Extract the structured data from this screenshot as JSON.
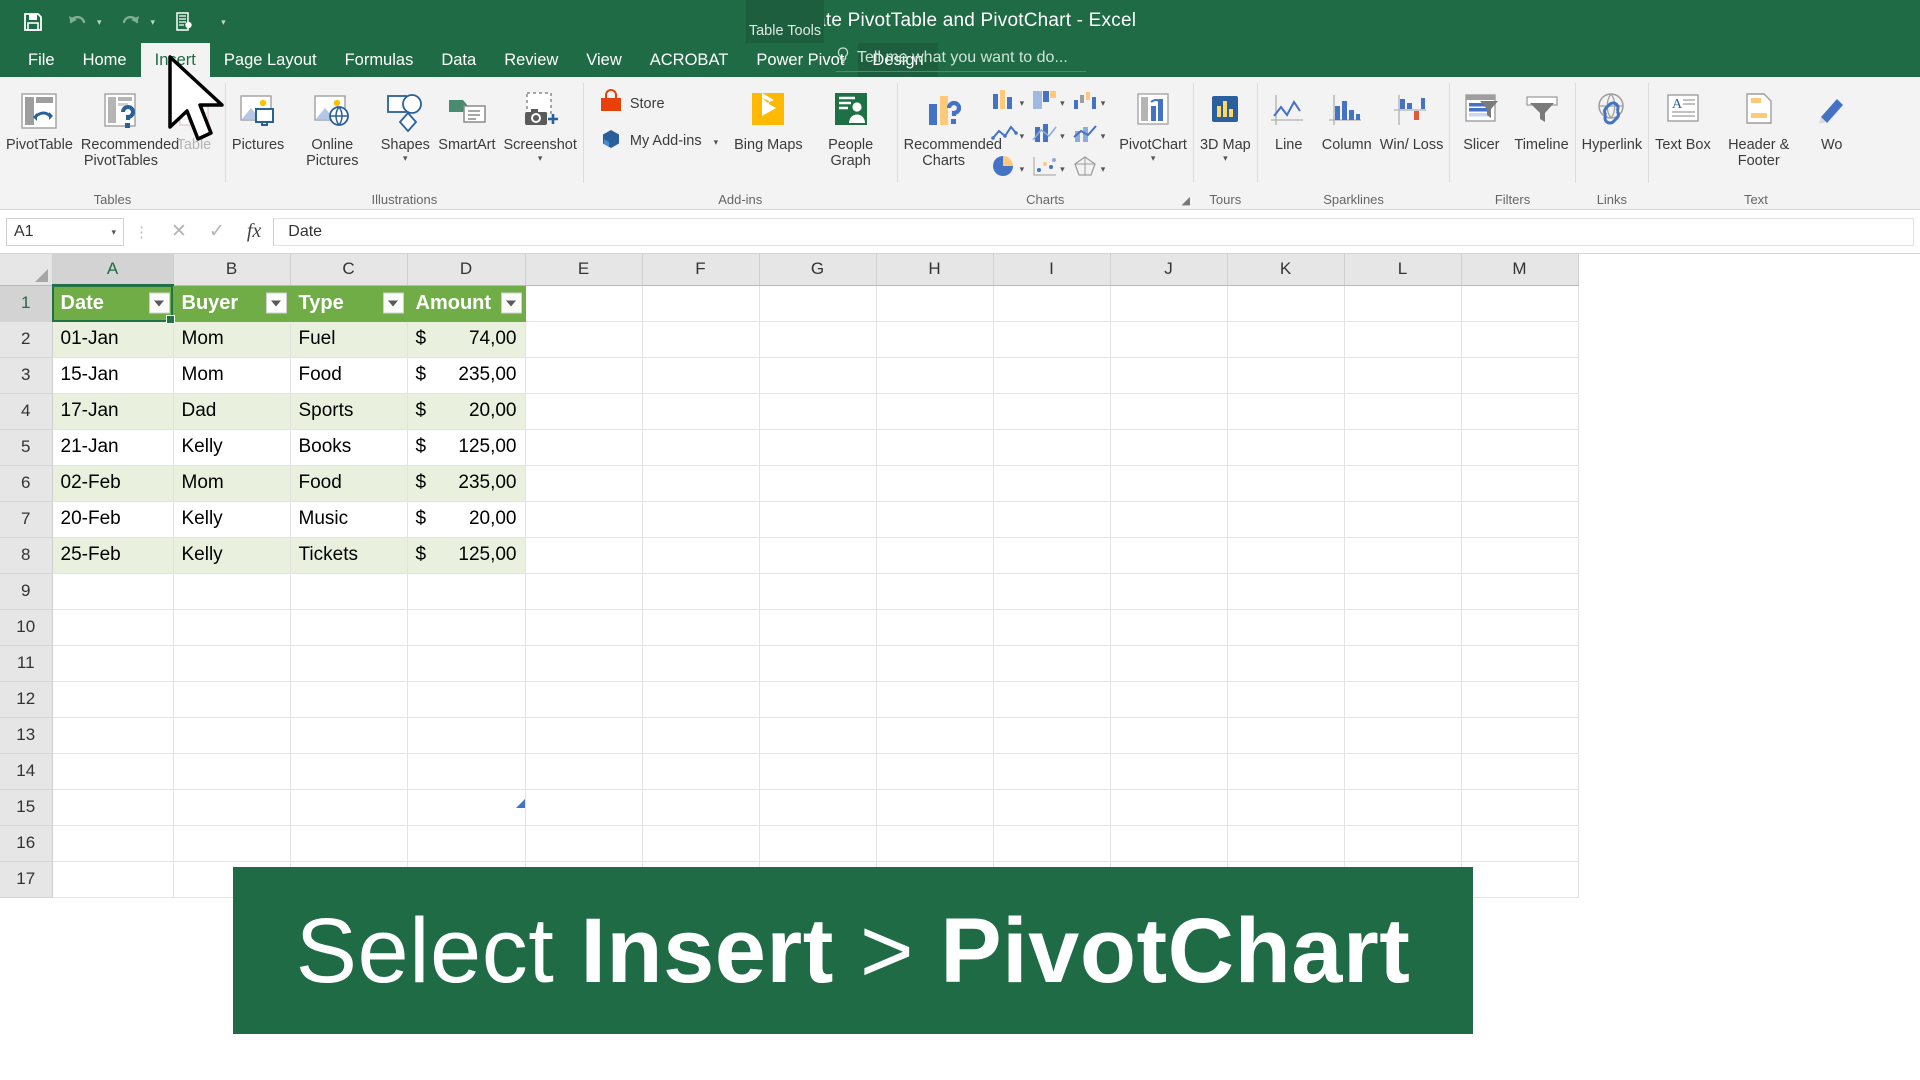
{
  "titlebar": {
    "document_title": "Create PivotTable and PivotChart - Excel",
    "contextual_tab_group": "Table Tools",
    "quick_access": [
      {
        "name": "save-icon",
        "label": "Save"
      },
      {
        "name": "undo-icon",
        "label": "Undo"
      },
      {
        "name": "redo-icon",
        "label": "Redo"
      },
      {
        "name": "print-preview-icon",
        "label": "Print Preview and Print"
      },
      {
        "name": "customize-qat-icon",
        "label": "Customize Quick Access Toolbar"
      }
    ]
  },
  "tabs": [
    {
      "label": "File",
      "active": false
    },
    {
      "label": "Home",
      "active": false
    },
    {
      "label": "Insert",
      "active": true
    },
    {
      "label": "Page Layout",
      "active": false
    },
    {
      "label": "Formulas",
      "active": false
    },
    {
      "label": "Data",
      "active": false
    },
    {
      "label": "Review",
      "active": false
    },
    {
      "label": "View",
      "active": false
    },
    {
      "label": "ACROBAT",
      "active": false
    },
    {
      "label": "Power Pivot",
      "active": false
    },
    {
      "label": "Design",
      "active": false,
      "contextual": true
    }
  ],
  "tellme": {
    "placeholder": "Tell me what you want to do...",
    "icon": "lightbulb-icon"
  },
  "ribbon": {
    "groups": [
      {
        "label": "Tables",
        "items": [
          {
            "label": "PivotTable",
            "icon": "pivottable-icon",
            "disabled": false
          },
          {
            "label": "Recommended PivotTables",
            "icon": "recommended-pivottables-icon",
            "disabled": false
          },
          {
            "label": "Table",
            "icon": "table-icon",
            "disabled": true
          }
        ]
      },
      {
        "label": "Illustrations",
        "items": [
          {
            "label": "Pictures",
            "icon": "pictures-icon",
            "disabled": false
          },
          {
            "label": "Online Pictures",
            "icon": "online-pictures-icon",
            "disabled": false
          },
          {
            "label": "Shapes",
            "icon": "shapes-icon",
            "disabled": false,
            "dropdown": true
          },
          {
            "label": "SmartArt",
            "icon": "smartart-icon",
            "disabled": false
          },
          {
            "label": "Screenshot",
            "icon": "screenshot-icon",
            "disabled": false,
            "dropdown": true
          }
        ]
      },
      {
        "label": "Add-ins",
        "items": [
          {
            "label": "Store",
            "icon": "store-icon",
            "disabled": false
          },
          {
            "label": "My Add-ins",
            "icon": "my-addins-icon",
            "disabled": false,
            "dropdown": true
          },
          {
            "label": "Bing Maps",
            "icon": "bing-maps-icon",
            "disabled": false
          },
          {
            "label": "People Graph",
            "icon": "people-graph-icon",
            "disabled": false
          }
        ]
      },
      {
        "label": "Charts",
        "items": [
          {
            "label": "Recommended Charts",
            "icon": "recommended-charts-icon",
            "disabled": false
          },
          {
            "label": "Column or Bar Chart",
            "icon": "column-chart-icon",
            "disabled": false,
            "dropdown": true
          },
          {
            "label": "Hierarchy Chart",
            "icon": "hierarchy-chart-icon",
            "disabled": false,
            "dropdown": true
          },
          {
            "label": "Waterfall or Stock Chart",
            "icon": "waterfall-chart-icon",
            "disabled": false,
            "dropdown": true
          },
          {
            "label": "Line or Area Chart",
            "icon": "line-chart-icon",
            "disabled": false,
            "dropdown": true
          },
          {
            "label": "Statistic Chart",
            "icon": "statistic-chart-icon",
            "disabled": false,
            "dropdown": true
          },
          {
            "label": "Combo Chart",
            "icon": "combo-chart-icon",
            "disabled": false,
            "dropdown": true
          },
          {
            "label": "Pie or Doughnut Chart",
            "icon": "pie-chart-icon",
            "disabled": false,
            "dropdown": true
          },
          {
            "label": "Scatter or Bubble Chart",
            "icon": "scatter-chart-icon",
            "disabled": false,
            "dropdown": true
          },
          {
            "label": "Surface or Radar Chart",
            "icon": "radar-chart-icon",
            "disabled": false,
            "dropdown": true
          },
          {
            "label": "PivotChart",
            "icon": "pivotchart-icon",
            "disabled": false,
            "dropdown": true
          }
        ],
        "dialog_launcher": true
      },
      {
        "label": "Tours",
        "items": [
          {
            "label": "3D Map",
            "icon": "3d-map-icon",
            "disabled": false,
            "dropdown": true
          }
        ]
      },
      {
        "label": "Sparklines",
        "items": [
          {
            "label": "Line",
            "icon": "sparkline-line-icon",
            "disabled": false
          },
          {
            "label": "Column",
            "icon": "sparkline-column-icon",
            "disabled": false
          },
          {
            "label": "Win/ Loss",
            "icon": "sparkline-winloss-icon",
            "disabled": false
          }
        ]
      },
      {
        "label": "Filters",
        "items": [
          {
            "label": "Slicer",
            "icon": "slicer-icon",
            "disabled": false
          },
          {
            "label": "Timeline",
            "icon": "timeline-icon",
            "disabled": false
          }
        ]
      },
      {
        "label": "Links",
        "items": [
          {
            "label": "Hyperlink",
            "icon": "hyperlink-icon",
            "disabled": false
          }
        ]
      },
      {
        "label": "Text",
        "items": [
          {
            "label": "Text Box",
            "icon": "textbox-icon",
            "disabled": false
          },
          {
            "label": "Header & Footer",
            "icon": "header-footer-icon",
            "disabled": false
          },
          {
            "label": "Wo",
            "icon": "wordart-icon",
            "disabled": false
          }
        ]
      }
    ]
  },
  "formula_bar": {
    "name_box": "A1",
    "cancel_icon": "cancel-icon",
    "enter_icon": "enter-icon",
    "function_icon": "insert-function-icon",
    "formula_value": "Date"
  },
  "grid": {
    "column_headers": [
      "A",
      "B",
      "C",
      "D",
      "E",
      "F",
      "G",
      "H",
      "I",
      "J",
      "K",
      "L",
      "M"
    ],
    "selected_column": "A",
    "row_numbers": [
      "1",
      "2",
      "3",
      "4",
      "5",
      "6",
      "7",
      "8",
      "9",
      "10",
      "11",
      "12",
      "13",
      "14",
      "15",
      "16",
      "17"
    ],
    "selected_row": "1",
    "table_headers": [
      "Date",
      "Buyer",
      "Type",
      "Amount"
    ],
    "rows": [
      {
        "date": "01-Jan",
        "buyer": "Mom",
        "type": "Fuel",
        "amount_symbol": "$",
        "amount": "74,00"
      },
      {
        "date": "15-Jan",
        "buyer": "Mom",
        "type": "Food",
        "amount_symbol": "$",
        "amount": "235,00"
      },
      {
        "date": "17-Jan",
        "buyer": "Dad",
        "type": "Sports",
        "amount_symbol": "$",
        "amount": "20,00"
      },
      {
        "date": "21-Jan",
        "buyer": "Kelly",
        "type": "Books",
        "amount_symbol": "$",
        "amount": "125,00"
      },
      {
        "date": "02-Feb",
        "buyer": "Mom",
        "type": "Food",
        "amount_symbol": "$",
        "amount": "235,00"
      },
      {
        "date": "20-Feb",
        "buyer": "Kelly",
        "type": "Music",
        "amount_symbol": "$",
        "amount": "20,00"
      },
      {
        "date": "25-Feb",
        "buyer": "Kelly",
        "type": "Tickets",
        "amount_symbol": "$",
        "amount": "125,00"
      }
    ]
  },
  "banner": {
    "prefix": "Select ",
    "emphasis_1": "Insert",
    "separator": " > ",
    "emphasis_2": "PivotChart",
    "background_color": "#1e6b45",
    "text_color": "#ffffff"
  },
  "colors": {
    "excel_green": "#1e6b45",
    "table_header_green": "#70ad47",
    "band_green": "#e9f1de",
    "active_cell_border": "#217346"
  }
}
